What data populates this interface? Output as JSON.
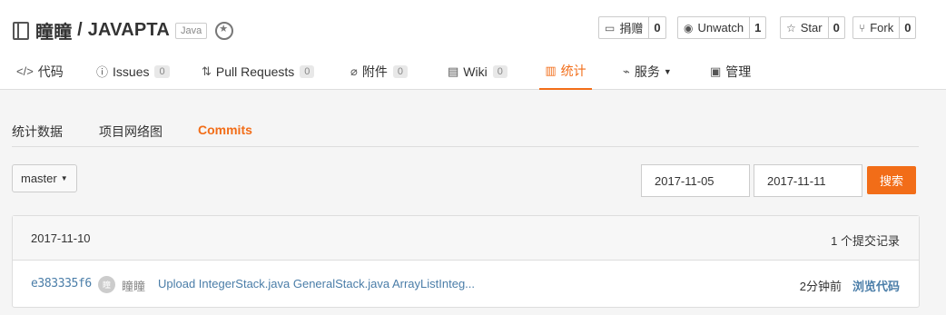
{
  "repo": {
    "owner": "瞳瞳",
    "separator": " / ",
    "name": "JAVAPTA",
    "language": "Java"
  },
  "actions": [
    {
      "label": "捐赠",
      "count": "0",
      "icon": "donate-icon"
    },
    {
      "label": "Unwatch",
      "count": "1",
      "icon": "eye-icon"
    },
    {
      "label": "Star",
      "count": "0",
      "icon": "star-icon"
    },
    {
      "label": "Fork",
      "count": "0",
      "icon": "fork-icon"
    }
  ],
  "nav": [
    {
      "label": "代码",
      "icon": "code-icon"
    },
    {
      "label": "Issues",
      "count": "0",
      "icon": "issue-icon"
    },
    {
      "label": "Pull Requests",
      "count": "0",
      "icon": "pull-request-icon"
    },
    {
      "label": "附件",
      "count": "0",
      "icon": "attachment-icon"
    },
    {
      "label": "Wiki",
      "count": "0",
      "icon": "wiki-icon"
    },
    {
      "label": "统计",
      "icon": "chart-icon",
      "active": true
    },
    {
      "label": "服务",
      "icon": "pulse-icon"
    },
    {
      "label": "管理",
      "icon": "manage-icon"
    }
  ],
  "subnav": [
    {
      "label": "统计数据"
    },
    {
      "label": "项目网络图"
    },
    {
      "label": "Commits",
      "active": true
    }
  ],
  "filter": {
    "branch": "master",
    "start_date": "2017-11-05",
    "end_date": "2017-11-11",
    "search_label": "搜索"
  },
  "commits": {
    "date": "2017-11-10",
    "count_text": "1 个提交记录",
    "rows": [
      {
        "sha": "e383335f6",
        "avatar": "瞳",
        "author": "瞳瞳",
        "message": "Upload IntegerStack.java GeneralStack.java ArrayListInteg...",
        "time": "2分钟前",
        "browse": "浏览代码"
      }
    ]
  },
  "colors": {
    "accent": "#f26d18",
    "link": "#4a7da8"
  }
}
